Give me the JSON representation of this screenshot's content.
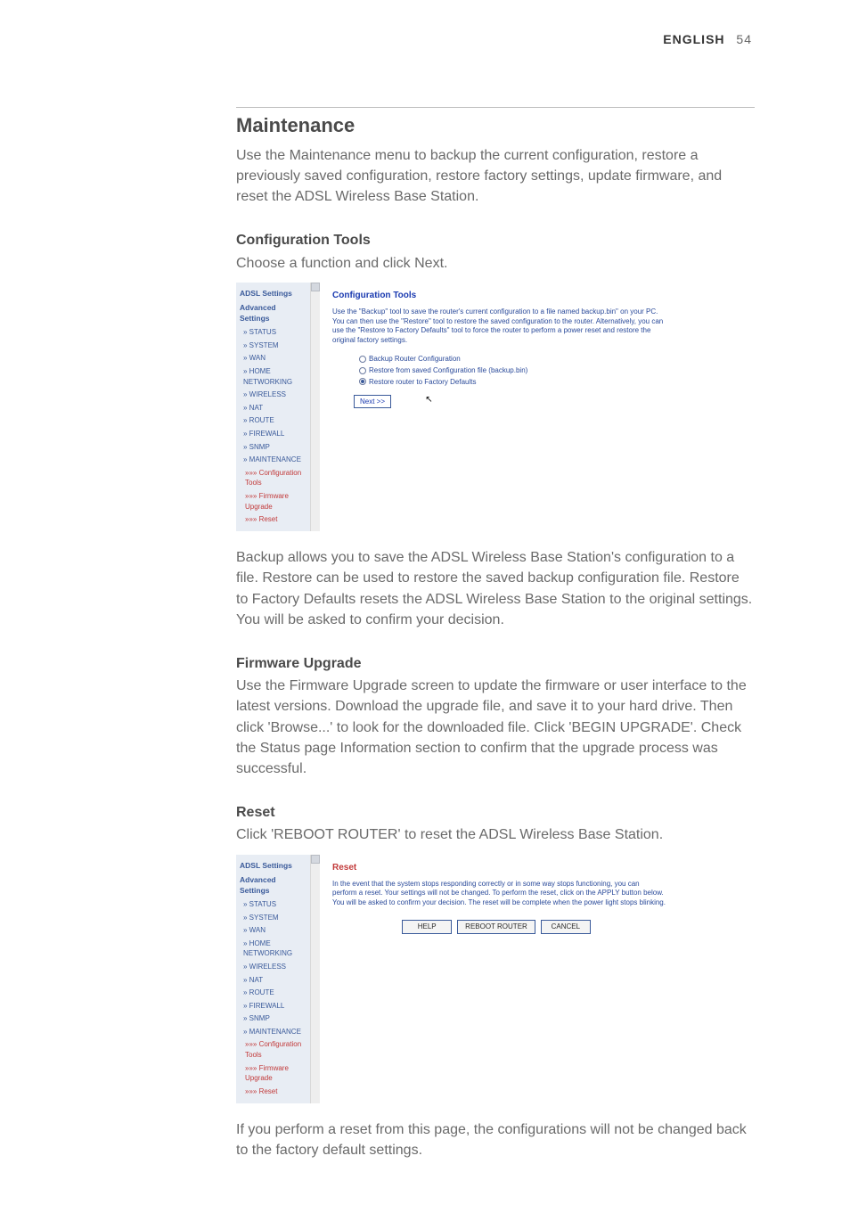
{
  "header": {
    "lang": "ENGLISH",
    "page_number": "54"
  },
  "sections": {
    "maintenance_title": "Maintenance",
    "maintenance_intro": "Use the Maintenance menu to backup the current configuration, restore a previously saved configuration, restore factory settings, update firmware, and reset the ADSL Wireless Base Station.",
    "config_h": "Configuration Tools",
    "config_p": "Choose a function and click Next.",
    "backup_p": "Backup allows you to save the ADSL Wireless Base Station's configuration to a file. Restore can be used to restore the saved backup configuration file. Restore to Factory Defaults resets the ADSL Wireless Base Station to the original settings. You will be asked to confirm your decision.",
    "fw_h": "Firmware Upgrade",
    "fw_p": "Use the Firmware Upgrade screen to update the firmware or user interface to the latest versions. Download the upgrade file, and save it to your hard drive. Then click 'Browse...' to look for the downloaded file. Click 'BEGIN UPGRADE'. Check the Status page Information section to confirm that the upgrade process was successful.",
    "reset_h": "Reset",
    "reset_p": "Click 'REBOOT ROUTER' to reset the ADSL Wireless Base Station.",
    "final_p": "If you perform a reset from this page, the configurations will not be changed back to the factory default settings."
  },
  "shot_sidebar": {
    "head1": "ADSL Settings",
    "head2": "Advanced Settings",
    "items": [
      "» STATUS",
      "» SYSTEM",
      "» WAN",
      "» HOME NETWORKING",
      "» WIRELESS",
      "» NAT",
      "» ROUTE",
      "» FIREWALL",
      "» SNMP",
      "» MAINTENANCE"
    ],
    "subs": [
      "»»» Configuration Tools",
      "»»» Firmware Upgrade",
      "»»» Reset"
    ]
  },
  "shot1": {
    "title": "Configuration Tools",
    "desc": "Use the \"Backup\" tool to save the router's current configuration to a file named backup.bin\" on your PC. You can then use the \"Restore\" tool to restore the saved configuration to the router. Alternatively, you can use the \"Restore to Factory Defaults\" tool to force the router to perform a power reset and restore the original factory settings.",
    "radios": [
      {
        "label": "Backup Router Configuration",
        "selected": false
      },
      {
        "label": "Restore from saved Configuration file (backup.bin)",
        "selected": false
      },
      {
        "label": "Restore router to Factory Defaults",
        "selected": true
      }
    ],
    "next": "Next >>"
  },
  "shot2": {
    "title": "Reset",
    "desc": "In the event that the system stops responding correctly or in some way stops functioning, you can perform a reset. Your settings will not be changed. To perform the reset, click on the APPLY button below. You will be asked to confirm your decision. The reset will be complete when the power light stops blinking.",
    "buttons": {
      "help": "HELP",
      "reboot": "REBOOT ROUTER",
      "cancel": "CANCEL"
    }
  }
}
